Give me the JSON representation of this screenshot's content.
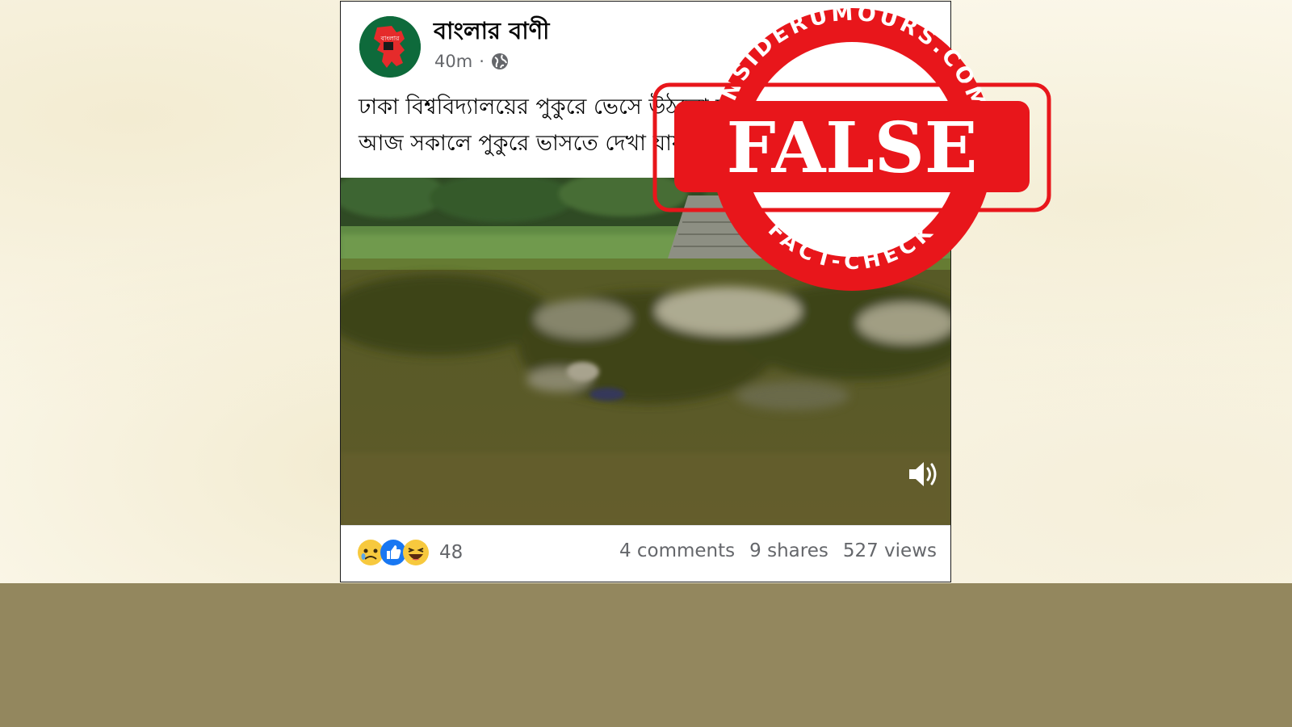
{
  "post": {
    "page_name": "বাংলার বাণী",
    "time": "40m",
    "separator": "·",
    "text_line1": "ঢাকা বিশ্ববিদ্যালয়ের পুকুরে ভেসে উঠলো ছাত্রীর লাশ।",
    "text_line2": "আজ সকালে পুকুরে ভাসতে দেখা যায়।",
    "avatar_label": "বাংলার"
  },
  "footer": {
    "reaction_count": "48",
    "comments": "4 comments",
    "shares": "9 shares",
    "views": "527 views"
  },
  "stamp": {
    "arc_top": "INSIDERUMOURS.COM",
    "verdict": "FALSE",
    "arc_bottom": "FACT-CHECK",
    "color": "#e8161b"
  },
  "icons": {
    "privacy": "globe-icon",
    "sound": "speaker-icon"
  }
}
